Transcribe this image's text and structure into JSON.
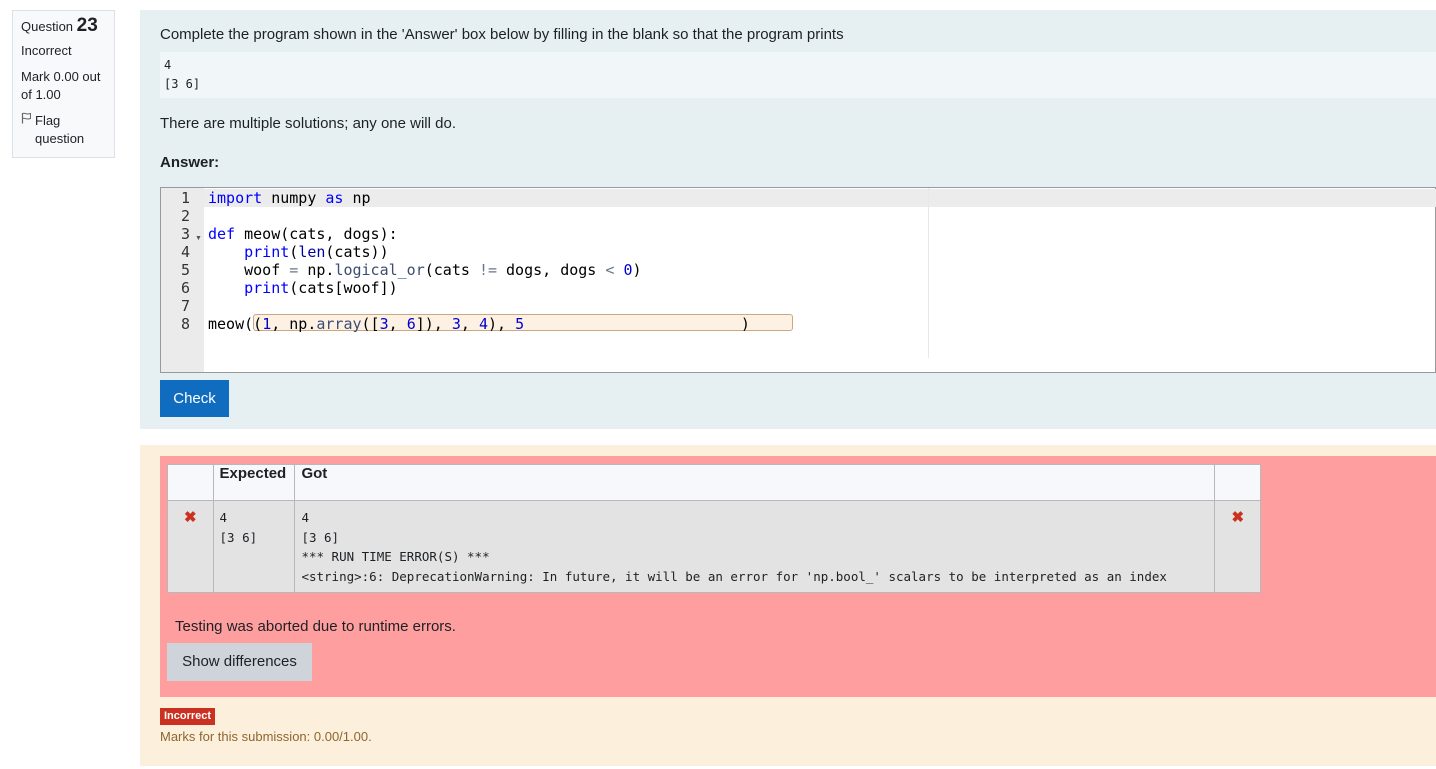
{
  "info": {
    "question_label": "Question",
    "question_number": "23",
    "state": "Incorrect",
    "grade": "Mark 0.00 out of 1.00",
    "flag_label": "Flag question"
  },
  "question": {
    "text1": "Complete the program shown in the 'Answer' box below by filling in the blank so that the program prints",
    "expected_output": "4\n[3 6]",
    "text2": "There are multiple solutions; any one will do.",
    "answer_label": "Answer:",
    "line_numbers": [
      "1",
      "2",
      "3",
      "4",
      "5",
      "6",
      "7",
      "8"
    ],
    "answer_blank": "(1, np.array([3, 6]), 3, 4), 5",
    "check_label": "Check"
  },
  "results": {
    "headers": [
      "",
      "Expected",
      "Got",
      ""
    ],
    "row": {
      "expected": "4\n[3 6]",
      "got": "4\n[3 6]\n*** RUN TIME ERROR(S) ***\n<string>:6: DeprecationWarning: In future, it will be an error for 'np.bool_' scalars to be interpreted as an index"
    },
    "abort_message": "Testing was aborted due to runtime errors.",
    "show_differences_label": "Show differences"
  },
  "feedback": {
    "badge": "Incorrect",
    "marks": "Marks for this submission: 0.00/1.00."
  },
  "colors": {
    "formulation_bg": "#e6f0f3",
    "outcome_bg": "#fcefdc",
    "results_bg": "#ff9e9e",
    "check_button": "#0f6cbf",
    "incorrect_badge": "#ca3120"
  },
  "icons": {
    "flag": "flag-icon",
    "fail": "cross-icon",
    "fold": "fold-arrow-icon"
  }
}
